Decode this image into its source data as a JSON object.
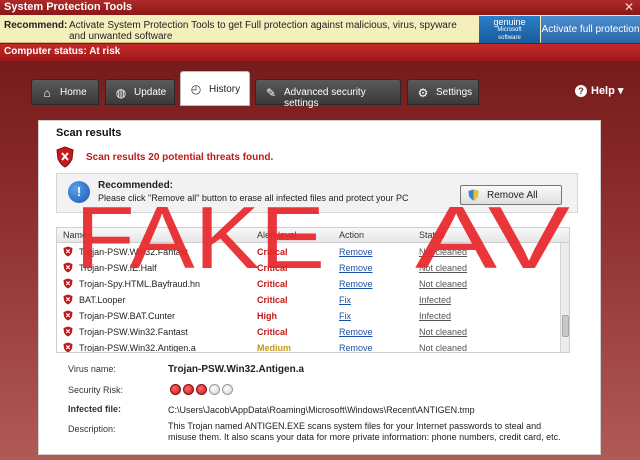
{
  "window": {
    "title": "System Protection Tools",
    "close_glyph": "✕"
  },
  "recommend_bar": {
    "label": "Recommend:",
    "message": "Activate System Protection Tools to get Full protection against malicious, virus, spyware and unwanted software",
    "genuine_line1": "genuine",
    "genuine_line2": "Microsoft",
    "genuine_line3": "software",
    "activate_button": "Activate full protection"
  },
  "status": {
    "text": "Computer status: At risk"
  },
  "tabs": [
    {
      "label": "Home",
      "icon": "home-icon",
      "glyph": "⌂"
    },
    {
      "label": "Update",
      "icon": "globe-icon",
      "glyph": "◍"
    },
    {
      "label": "History",
      "icon": "history-icon",
      "glyph": "◴",
      "active": true
    },
    {
      "label": "Advanced security settings",
      "icon": "wrench-icon",
      "glyph": "✎"
    },
    {
      "label": "Settings",
      "icon": "gear-icon",
      "glyph": "⚙"
    }
  ],
  "help": {
    "label": "Help",
    "glyph": "?"
  },
  "scan": {
    "heading": "Scan results",
    "threats_message": "Scan results 20 potential threats found."
  },
  "recommended": {
    "title": "Recommended:",
    "text": "Please click \"Remove all\" button to erase all infected files and protect your PC",
    "remove_all_button": "Remove All"
  },
  "table": {
    "headers": [
      "Name",
      "Alert level",
      "Action",
      "Status"
    ],
    "rows": [
      {
        "name": "Trojan-PSW.Win32.Fantast",
        "level": "Critical",
        "level_class": "crit",
        "action": "Remove",
        "status": "Not cleaned"
      },
      {
        "name": "Trojan-PSW.IE.Half",
        "level": "Critical",
        "level_class": "crit",
        "action": "Remove",
        "status": "Not cleaned"
      },
      {
        "name": "Trojan-Spy.HTML.Bayfraud.hn",
        "level": "Critical",
        "level_class": "crit",
        "action": "Remove",
        "status": "Not cleaned"
      },
      {
        "name": "BAT.Looper",
        "level": "Critical",
        "level_class": "crit",
        "action": "Fix",
        "status": "Infected"
      },
      {
        "name": "Trojan-PSW.BAT.Cunter",
        "level": "High",
        "level_class": "high",
        "action": "Fix",
        "status": "Infected"
      },
      {
        "name": "Trojan-PSW.Win32.Fantast",
        "level": "Critical",
        "level_class": "crit",
        "action": "Remove",
        "status": "Not cleaned"
      },
      {
        "name": "Trojan-PSW.Win32.Antigen.a",
        "level": "Medium",
        "level_class": "med",
        "action": "Remove",
        "status": "Not cleaned"
      }
    ]
  },
  "details": {
    "virus_label": "Virus name:",
    "virus_value": "Trojan-PSW.Win32.Antigen.a",
    "risk_label": "Security Risk:",
    "risk_level": 3,
    "risk_max": 5,
    "infected_label": "Infected file:",
    "infected_value": "C:\\Users\\Jacob\\AppData\\Roaming\\Microsoft\\Windows\\Recent\\ANTIGEN.tmp",
    "desc_label": "Description:",
    "desc_value": "This Trojan named ANTIGEN.EXE scans system files for your Internet passwords to steal and misuse them. It also scans your data for more private information: phone numbers, credit card, etc."
  },
  "overlay": {
    "text_left": "FAKE",
    "text_right": "AV",
    "color": "#e8262a"
  },
  "colors": {
    "critical": "#c01a1a",
    "medium": "#c39a13",
    "link": "#1a4fa8",
    "titlebar": "#8a1717"
  }
}
